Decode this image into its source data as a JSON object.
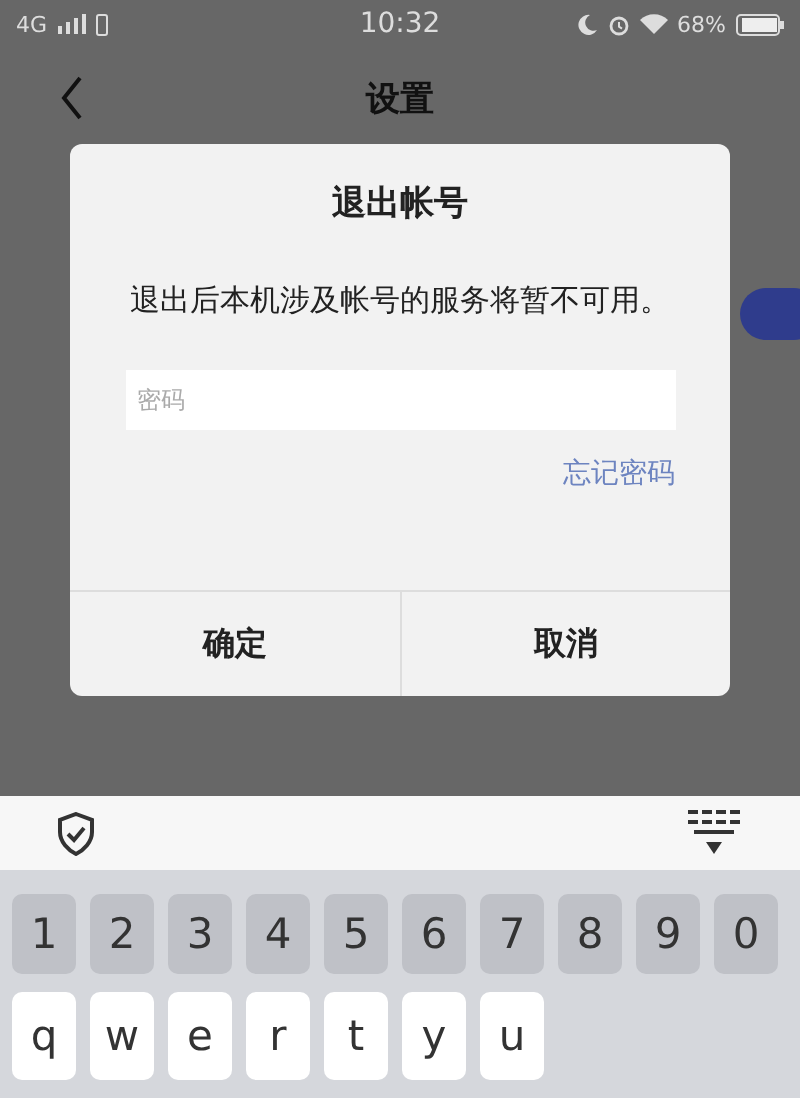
{
  "status_bar": {
    "network": "4G",
    "time": "10:32",
    "battery": "68%"
  },
  "nav_bar": {
    "title": "设置"
  },
  "settings": {
    "toggle_on": true
  },
  "dialog": {
    "title": "退出帐号",
    "message": "退出后本机涉及帐号的服务将暂不可用。",
    "password": {
      "placeholder": "密码"
    },
    "link": "忘记密码",
    "buttons": [
      {
        "label": "确定"
      },
      {
        "label": "取消"
      }
    ]
  },
  "keyboard": {
    "rows": [
      {
        "kind": "digits",
        "keys": [
          "1",
          "2",
          "3",
          "4",
          "5",
          "6",
          "7",
          "8",
          "9",
          "0"
        ]
      },
      {
        "kind": "letters",
        "keys": [
          "q",
          "w",
          "e",
          "r",
          "t",
          "y",
          "u"
        ]
      }
    ]
  }
}
